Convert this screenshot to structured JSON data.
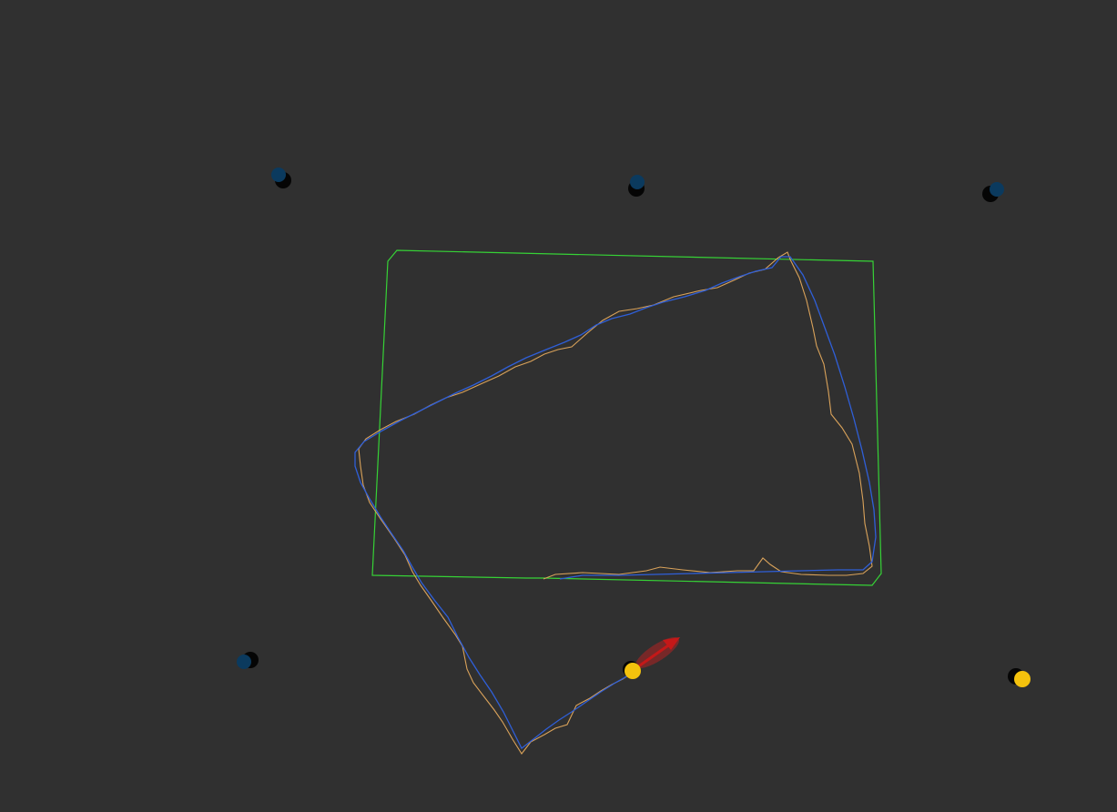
{
  "scene": {
    "background_color": "#303030",
    "colors": {
      "anchor_blue": "#0b3a5e",
      "anchor_shadow": "#050505",
      "tag_yellow": "#f4c20d",
      "boundary_green": "#36d236",
      "trajectory_blue": "#2f5fd8",
      "trajectory_orange": "#d9a25a",
      "heading_arrow_red": "#c41818"
    },
    "items": {
      "anchors": [
        "anchor-1",
        "anchor-2",
        "anchor-3",
        "anchor-4"
      ],
      "tags": [
        "tag-current",
        "tag-secondary"
      ],
      "paths": [
        "estimated-path",
        "raw-path"
      ],
      "boundary": "boundary-rectangle",
      "heading": "heading-arrow"
    }
  }
}
